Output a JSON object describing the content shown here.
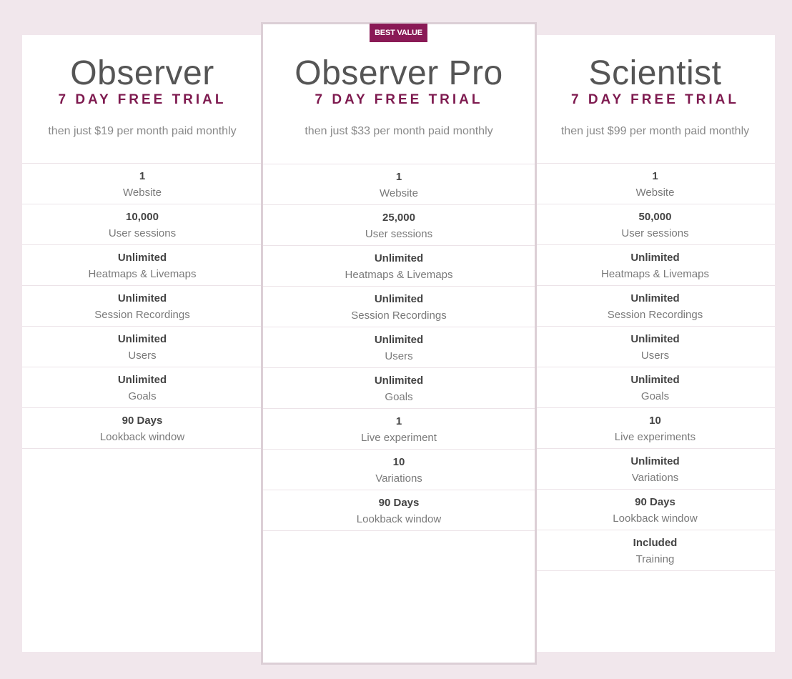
{
  "plans": [
    {
      "name": "Observer",
      "trial": "7 DAY FREE TRIAL",
      "price": "then just $19 per month paid monthly",
      "features": [
        {
          "value": "1",
          "label": "Website"
        },
        {
          "value": "10,000",
          "label": "User sessions"
        },
        {
          "value": "Unlimited",
          "label": "Heatmaps & Livemaps"
        },
        {
          "value": "Unlimited",
          "label": "Session Recordings"
        },
        {
          "value": "Unlimited",
          "label": "Users"
        },
        {
          "value": "Unlimited",
          "label": "Goals"
        },
        {
          "value": "90 Days",
          "label": "Lookback window"
        }
      ]
    },
    {
      "name": "Observer Pro",
      "badge": "BEST VALUE",
      "trial": "7 DAY FREE TRIAL",
      "price": "then just $33 per month paid monthly",
      "features": [
        {
          "value": "1",
          "label": "Website"
        },
        {
          "value": "25,000",
          "label": "User sessions"
        },
        {
          "value": "Unlimited",
          "label": "Heatmaps & Livemaps"
        },
        {
          "value": "Unlimited",
          "label": "Session Recordings"
        },
        {
          "value": "Unlimited",
          "label": "Users"
        },
        {
          "value": "Unlimited",
          "label": "Goals"
        },
        {
          "value": "1",
          "label": "Live experiment"
        },
        {
          "value": "10",
          "label": "Variations"
        },
        {
          "value": "90 Days",
          "label": "Lookback window"
        }
      ]
    },
    {
      "name": "Scientist",
      "trial": "7 DAY FREE TRIAL",
      "price": "then just $99 per month paid monthly",
      "features": [
        {
          "value": "1",
          "label": "Website"
        },
        {
          "value": "50,000",
          "label": "User sessions"
        },
        {
          "value": "Unlimited",
          "label": "Heatmaps & Livemaps"
        },
        {
          "value": "Unlimited",
          "label": "Session Recordings"
        },
        {
          "value": "Unlimited",
          "label": "Users"
        },
        {
          "value": "Unlimited",
          "label": "Goals"
        },
        {
          "value": "10",
          "label": "Live experiments"
        },
        {
          "value": "Unlimited",
          "label": "Variations"
        },
        {
          "value": "90 Days",
          "label": "Lookback window"
        },
        {
          "value": "Included",
          "label": "Training"
        }
      ]
    }
  ],
  "colors": {
    "accent": "#8a1a56",
    "background": "#f1e7ec",
    "highlight_border": "#dccfd6"
  }
}
